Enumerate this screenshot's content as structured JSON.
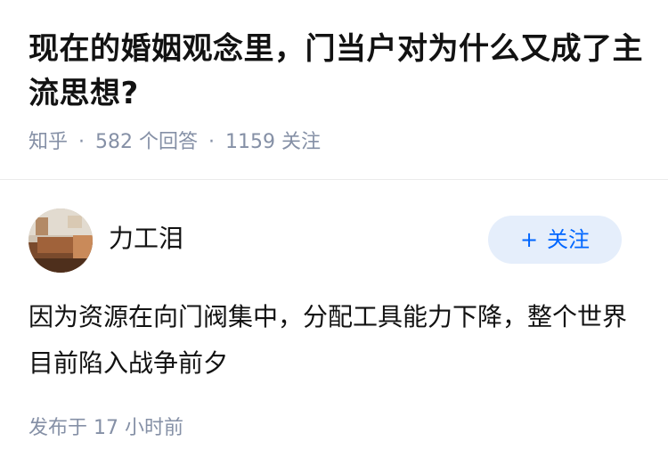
{
  "question": {
    "title": "现在的婚姻观念里，门当户对为什么又成了主流思想?",
    "source": "知乎",
    "separator": "·",
    "answer_count": "582 个回答",
    "follower_count": "1159 关注"
  },
  "answer": {
    "author_name": "力工泪",
    "follow_button": "关注",
    "follow_icon": "+",
    "content": "因为资源在向门阀集中，分配工具能力下降，整个世界目前陷入战争前夕",
    "published": "发布于 17 小时前"
  },
  "colors": {
    "accent": "#0066ff",
    "button_bg": "#e5eefb",
    "meta_text": "#8590a6",
    "body_text": "#121212"
  }
}
